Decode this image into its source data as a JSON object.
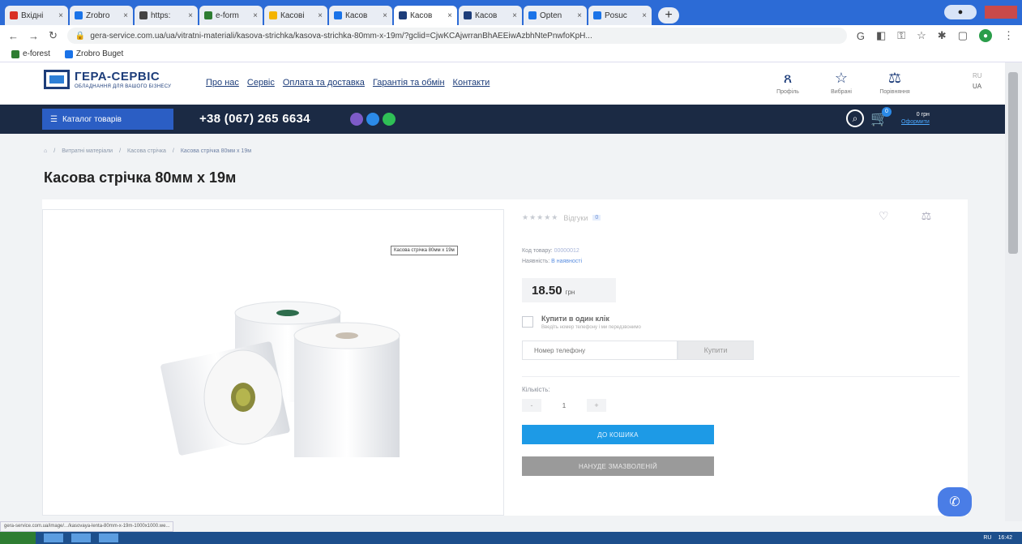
{
  "browser": {
    "tabs": [
      {
        "label": "Вхідні",
        "color": "#d93025",
        "active": false
      },
      {
        "label": "Zrobro",
        "color": "#1a73e8",
        "active": false
      },
      {
        "label": "https:",
        "color": "#444444",
        "active": false
      },
      {
        "label": "e-form",
        "color": "#2e7d32",
        "active": false
      },
      {
        "label": "Касові",
        "color": "#f4b400",
        "active": false
      },
      {
        "label": "Касов",
        "color": "#1a73e8",
        "active": false
      },
      {
        "label": "Касов",
        "color": "#1d3d7a",
        "active": true
      },
      {
        "label": "Касов",
        "color": "#1d3d7a",
        "active": false
      },
      {
        "label": "Opten",
        "color": "#1a73e8",
        "active": false
      },
      {
        "label": "Posuc",
        "color": "#1a73e8",
        "active": false
      }
    ],
    "new_tab": "+",
    "url": "gera-service.com.ua/ua/vitratni-materiali/kasova-strichka/kasova-strichka-80mm-x-19m/?gclid=CjwKCAjwrranBhAEEiwAzbhNtePnwfoKpH...",
    "bookmarks": [
      {
        "label": "e-forest",
        "color": "#2e7d32"
      },
      {
        "label": "Zrobro Buget",
        "color": "#1a73e8"
      }
    ]
  },
  "site": {
    "logo_title": "ГЕРА-СЕРВІС",
    "logo_sub": "ОБЛАДНАННЯ ДЛЯ ВАШОГО БІЗНЕСУ",
    "nav": [
      "Про нас",
      "Сервіс",
      "Оплата та доставка",
      "Гарантія та обмін",
      "Контакти"
    ],
    "header_icons": [
      {
        "glyph": "ጸ",
        "label": "Профіль"
      },
      {
        "glyph": "☆",
        "label": "Вибрані"
      },
      {
        "glyph": "⚖",
        "label": "Порівняння"
      }
    ],
    "lang_ru": "RU",
    "lang_ua": "UA",
    "catalog_label": "Каталог товарів",
    "phone": "+38 (067) 265 6634",
    "messenger_colors": [
      "#7d5bc8",
      "#2b8ae8",
      "#2fbf56"
    ],
    "cart_badge": "0",
    "cart_total": "0 грн",
    "cart_link": "Оформити"
  },
  "breadcrumb": {
    "home": "⌂",
    "items": [
      "Витратні матеріали",
      "Касова стрічка",
      "Касова стрічка 80мм х 19м"
    ]
  },
  "product": {
    "title": "Касова стрічка 80мм х 19м",
    "tooltip": "Касова стрічка 80мм х 19м",
    "stars": "★★★★★",
    "reviews_label": "Відгуки",
    "reviews_count": "0",
    "code_label": "Код товару:",
    "code_value": "00000012",
    "availability_label": "Наявність:",
    "availability_value": "В наявності",
    "price": "18.50",
    "currency": "грн",
    "oneclick_title": "Купити в один клік",
    "oneclick_sub": "Введіть номер телефону і ми передзвонимо",
    "phone_placeholder": "Номер телефону",
    "buy_label": "Купити",
    "qty_label": "Кількість:",
    "qty_minus": "-",
    "qty_value": "1",
    "qty_plus": "+",
    "cart_btn": "ДО КОШИКА",
    "compare_btn": "НАНУДЕ ЗМАЗВОЛЕНІЙ"
  },
  "status_url": "gera-service.com.ua/image/.../kasovaya-lenta-80mm-x-19m-1000x1000.we...",
  "taskbar_tray": [
    "RU",
    "16:42"
  ]
}
